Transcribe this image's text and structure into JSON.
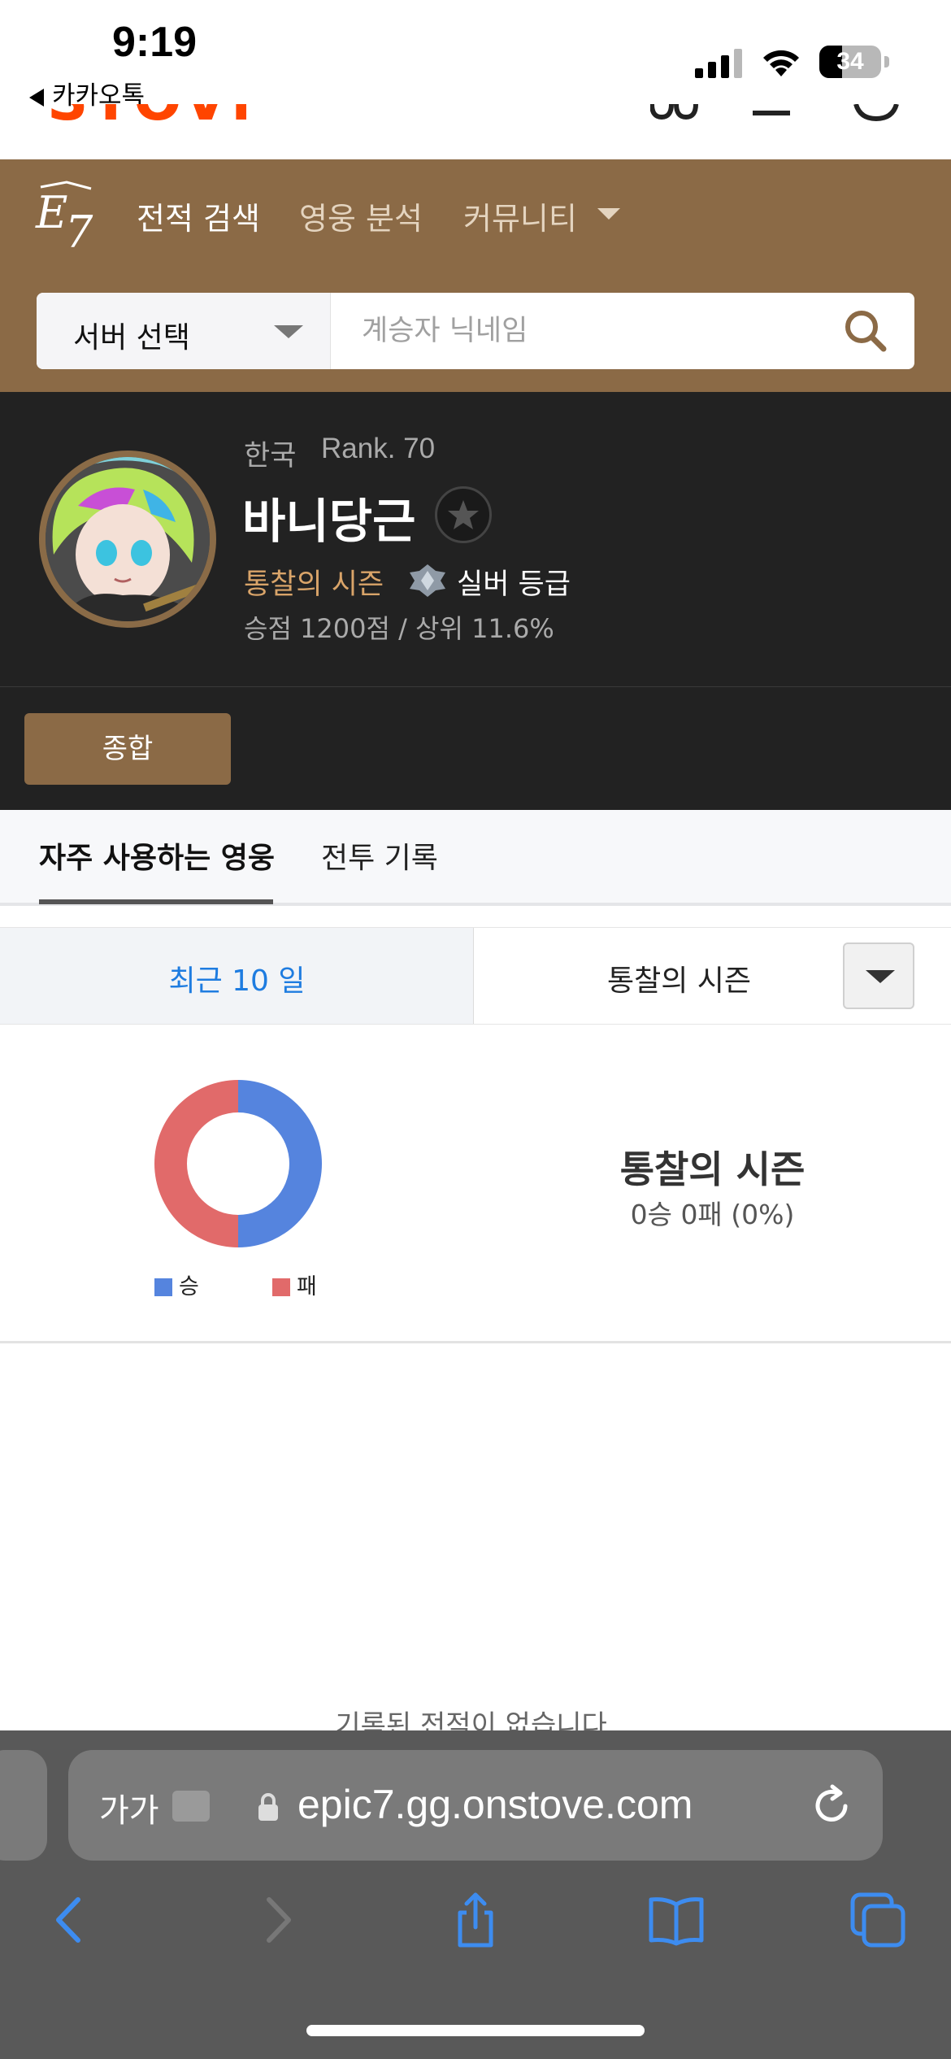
{
  "status_bar": {
    "time": "9:19",
    "back_app": "카카오톡",
    "battery": "34"
  },
  "nav": {
    "items": [
      {
        "label": "전적 검색",
        "active": true
      },
      {
        "label": "영웅 분석",
        "active": false
      },
      {
        "label": "커뮤니티",
        "active": false
      }
    ]
  },
  "search": {
    "server_label": "서버 선택",
    "placeholder": "계승자 닉네임"
  },
  "profile": {
    "region": "한국",
    "rank": "Rank. 70",
    "name": "바니당근",
    "season": "통찰의 시즌",
    "grade": "실버 등급",
    "score": "승점 1200점 / 상위 11.6%"
  },
  "overall_button": "종합",
  "subtabs": [
    {
      "label": "자주 사용하는 영웅",
      "active": true
    },
    {
      "label": "전투 기록",
      "active": false
    }
  ],
  "filter": {
    "left": "최근 10 일",
    "right": "통찰의 시즌"
  },
  "stats": {
    "title": "통찰의 시즌",
    "summary": "0승 0패 (0%)",
    "legend_win": "승",
    "legend_loss": "패",
    "win_color": "#5584de",
    "loss_color": "#e16a6a"
  },
  "no_record": "기록된 전적이 없습니다.",
  "browser": {
    "text_size": "가가",
    "url": "epic7.gg.onstove.com"
  }
}
